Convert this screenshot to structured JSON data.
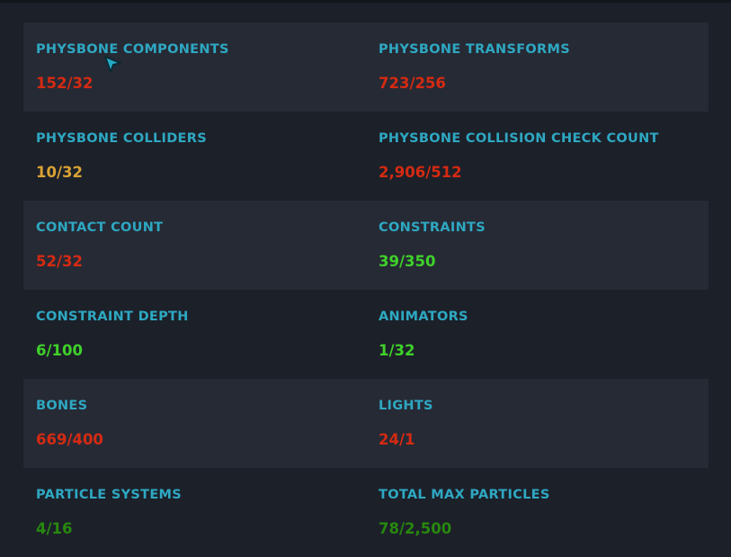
{
  "colors": {
    "label": "#2ea8c2",
    "over": "#d52a12",
    "warn": "#d9a234",
    "good": "#3fd12a",
    "good_dim": "#27880f"
  },
  "stats": [
    {
      "label": "PHYSBONE COMPONENTS",
      "value": "152/32",
      "status": "over"
    },
    {
      "label": "PHYSBONE TRANSFORMS",
      "value": "723/256",
      "status": "over"
    },
    {
      "label": "PHYSBONE COLLIDERS",
      "value": "10/32",
      "status": "warn"
    },
    {
      "label": "PHYSBONE COLLISION CHECK COUNT",
      "value": "2,906/512",
      "status": "over"
    },
    {
      "label": "CONTACT COUNT",
      "value": "52/32",
      "status": "over"
    },
    {
      "label": "CONSTRAINTS",
      "value": "39/350",
      "status": "good"
    },
    {
      "label": "CONSTRAINT DEPTH",
      "value": "6/100",
      "status": "good"
    },
    {
      "label": "ANIMATORS",
      "value": "1/32",
      "status": "good"
    },
    {
      "label": "BONES",
      "value": "669/400",
      "status": "over"
    },
    {
      "label": "LIGHTS",
      "value": "24/1",
      "status": "over"
    },
    {
      "label": "PARTICLE SYSTEMS",
      "value": "4/16",
      "status": "good_dim"
    },
    {
      "label": "TOTAL MAX PARTICLES",
      "value": "78/2,500",
      "status": "good_dim"
    }
  ]
}
